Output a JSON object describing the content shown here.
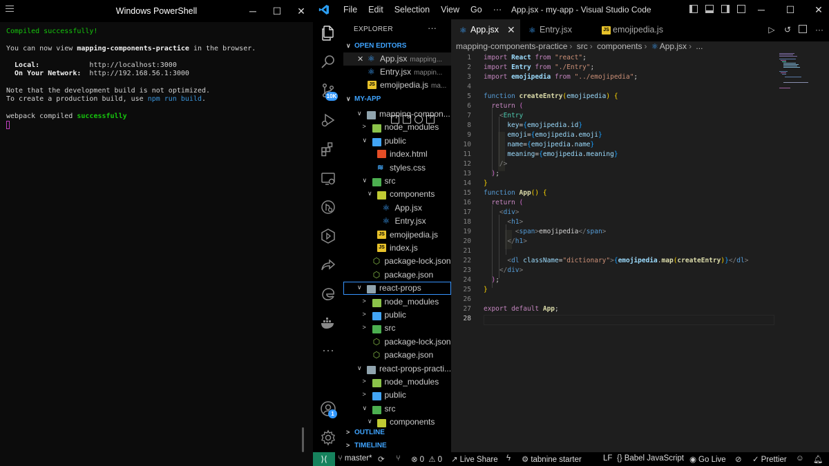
{
  "powershell": {
    "title": "Windows PowerShell",
    "minimize": "─",
    "maximize": "☐",
    "close": "✕",
    "lines": {
      "l1": "Compiled successfully!",
      "l2a": "You can now view ",
      "l2b": "mapping-components-practice",
      "l2c": " in the browser.",
      "l3a": "  Local:",
      "l3b": "            http://localhost:3000",
      "l4a": "  On Your Network:",
      "l4b": "  http://192.168.56.1:3000",
      "l5": "Note that the development build is not optimized.",
      "l6a": "To create a production build, use ",
      "l6b": "npm run build",
      "l6c": ".",
      "l7a": "webpack compiled ",
      "l7b": "successfully"
    }
  },
  "vscode": {
    "title": "App.jsx - my-app - Visual Studio Code",
    "menu": [
      "File",
      "Edit",
      "Selection",
      "View",
      "Go",
      "···"
    ],
    "window_controls": {
      "minimize": "─",
      "maximize": "☐",
      "close": "✕"
    },
    "activity_badges": {
      "source_control": "10K",
      "accounts": "1"
    },
    "explorer": {
      "header": "EXPLORER",
      "more": "···",
      "open_editors_label": "OPEN EDITORS",
      "open_editors": [
        {
          "name": "App.jsx",
          "sub": "mapping...",
          "close": "✕"
        },
        {
          "name": "Entry.jsx",
          "sub": "mappin..."
        },
        {
          "name": "emojipedia.js",
          "sub": "ma..."
        }
      ],
      "workspace_label": "MY-APP",
      "tree": [
        {
          "name": "mapping-compon...",
          "kind": "folder-open"
        },
        {
          "name": "node_modules",
          "kind": "folder"
        },
        {
          "name": "public",
          "kind": "folder-open"
        },
        {
          "name": "index.html",
          "kind": "html"
        },
        {
          "name": "styles.css",
          "kind": "css"
        },
        {
          "name": "src",
          "kind": "folder-open"
        },
        {
          "name": "components",
          "kind": "folder-open"
        },
        {
          "name": "App.jsx",
          "kind": "react"
        },
        {
          "name": "Entry.jsx",
          "kind": "react"
        },
        {
          "name": "emojipedia.js",
          "kind": "js"
        },
        {
          "name": "index.js",
          "kind": "js"
        },
        {
          "name": "package-lock.json",
          "kind": "json"
        },
        {
          "name": "package.json",
          "kind": "json"
        },
        {
          "name": "react-props",
          "kind": "folder-open"
        },
        {
          "name": "node_modules",
          "kind": "folder"
        },
        {
          "name": "public",
          "kind": "folder"
        },
        {
          "name": "src",
          "kind": "folder"
        },
        {
          "name": "package-lock.json",
          "kind": "json"
        },
        {
          "name": "package.json",
          "kind": "json"
        },
        {
          "name": "react-props-practi...",
          "kind": "folder-open"
        },
        {
          "name": "node_modules",
          "kind": "folder"
        },
        {
          "name": "public",
          "kind": "folder"
        },
        {
          "name": "src",
          "kind": "folder-open"
        },
        {
          "name": "components",
          "kind": "folder-open"
        }
      ],
      "outline_label": "OUTLINE",
      "timeline_label": "TIMELINE"
    },
    "tabs": [
      {
        "label": "App.jsx",
        "close": "✕"
      },
      {
        "label": "Entry.jsx"
      },
      {
        "label": "emojipedia.js"
      }
    ],
    "breadcrumb": [
      "mapping-components-practice",
      "src",
      "components",
      "App.jsx",
      "..."
    ],
    "code": {
      "line_numbers": [
        "1",
        "2",
        "3",
        "4",
        "5",
        "6",
        "7",
        "8",
        "9",
        "10",
        "11",
        "12",
        "13",
        "14",
        "15",
        "16",
        "17",
        "18",
        "19",
        "20",
        "21",
        "22",
        "23",
        "24",
        "25",
        "26",
        "27",
        "28"
      ],
      "t": {
        "import": "import",
        "from": "from",
        "function": "function",
        "return": "return",
        "export": "export",
        "default": "default",
        "React": "React",
        "Entry": "Entry",
        "emojipedia": "emojipedia",
        "createEntry": "createEntry",
        "App": "App",
        "s_react": "\"react\"",
        "s_entry": "\"./Entry\"",
        "s_emoji": "\"../emojipedia\"",
        "s_dict": "\"dictionary\"",
        "key": "key",
        "emoji": "emoji",
        "name": "name",
        "meaning": "meaning",
        "id": "id",
        "div": "div",
        "h1": "h1",
        "span": "span",
        "dl": "dl",
        "className": "className",
        "map": "map",
        "span_text": "emojipedia"
      }
    },
    "status": {
      "branch": "master*",
      "errors": "0",
      "warnings": "0",
      "live_share": "Live Share",
      "tabnine": "tabnine starter",
      "eol": "LF",
      "language": "Babel JavaScript",
      "go_live": "Go Live",
      "prettier": "Prettier"
    },
    "colors": {
      "accent": "#3794ff",
      "remote": "#16825d",
      "bg": "#1e1e1e"
    }
  }
}
